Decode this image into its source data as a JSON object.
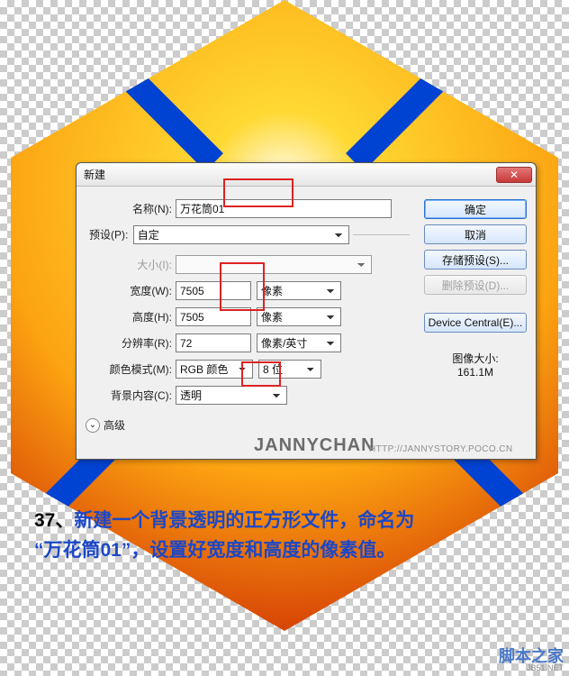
{
  "dialog": {
    "title": "新建",
    "name_label": "名称(N):",
    "name_value": "万花筒01",
    "preset_group_label": "预设(P):",
    "preset_value": "自定",
    "size_label": "大小(I):",
    "width_label": "宽度(W):",
    "width_value": "7505",
    "width_unit": "像素",
    "height_label": "高度(H):",
    "height_value": "7505",
    "height_unit": "像素",
    "res_label": "分辨率(R):",
    "res_value": "72",
    "res_unit": "像素/英寸",
    "mode_label": "颜色模式(M):",
    "mode_value": "RGB 颜色",
    "depth_value": "8 位",
    "bg_label": "背景内容(C):",
    "bg_value": "透明",
    "advanced_label": "高级",
    "filesize_label": "图像大小:",
    "filesize_value": "161.1M"
  },
  "buttons": {
    "ok": "确定",
    "cancel": "取消",
    "save_preset": "存储预设(S)...",
    "delete_preset": "删除预设(D)...",
    "device_central": "Device Central(E)..."
  },
  "caption": {
    "step_no": "37、",
    "line1": "新建一个背景透明的正方形文件，命名为",
    "line2_a": "“万花筒01”，",
    "line2_b": "设置好宽度和高度的像素值。"
  },
  "watermark": {
    "artist": "JANNYCHAN",
    "url": "HTTP://JANNYSTORY.POCO.CN",
    "site_line1": "脚本之家",
    "site_line2": "JB51.NET"
  }
}
